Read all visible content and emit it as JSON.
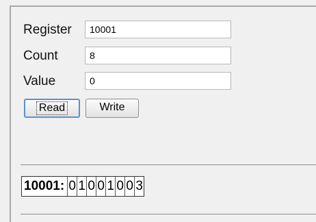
{
  "form": {
    "register": {
      "label": "Register",
      "value": "10001"
    },
    "count": {
      "label": "Count",
      "value": "8"
    },
    "value": {
      "label": "Value",
      "value": "0"
    }
  },
  "buttons": {
    "read": "Read",
    "write": "Write"
  },
  "result": {
    "key": "10001:",
    "bits": [
      "0",
      "1",
      "0",
      "0",
      "1",
      "0",
      "0",
      "3"
    ]
  }
}
